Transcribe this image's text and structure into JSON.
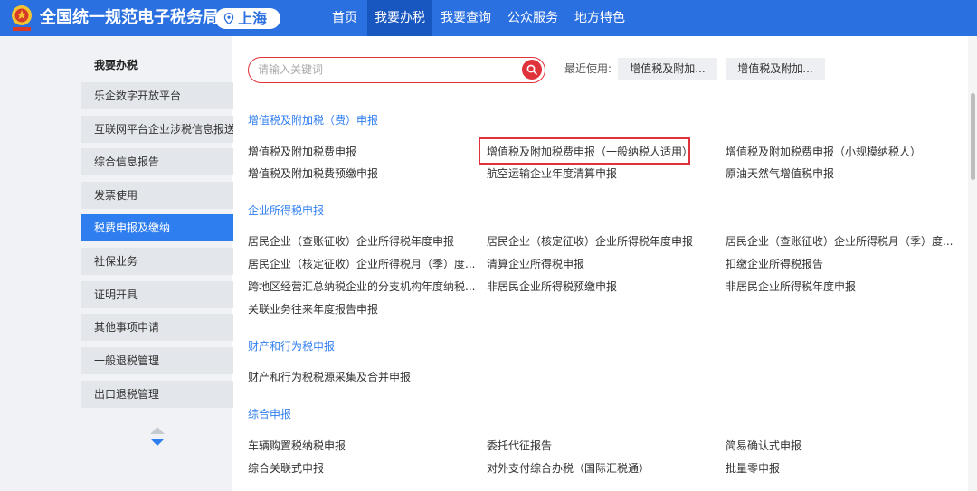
{
  "header": {
    "site_title": "全国统一规范电子税务局",
    "region": "上海",
    "nav": [
      "首页",
      "我要办税",
      "我要查询",
      "公众服务",
      "地方特色"
    ],
    "active_nav": "我要办税",
    "brand_color": "#2b70e0"
  },
  "sidebar": {
    "heading": "我要办税",
    "items": [
      "乐企数字开放平台",
      "互联网平台企业涉税信息报送",
      "综合信息报告",
      "发票使用",
      "税费申报及缴纳",
      "社保业务",
      "证明开具",
      "其他事项申请",
      "一般退税管理",
      "出口退税管理"
    ],
    "active_item": "税费申报及缴纳"
  },
  "search": {
    "placeholder": "请输入关键词",
    "recent_label": "最近使用:",
    "recent": [
      "增值税及附加...",
      "增值税及附加..."
    ]
  },
  "sections": [
    {
      "title": "增值税及附加税（费）申报",
      "items": [
        "增值税及附加税费申报",
        "增值税及附加税费申报（一般纳税人适用）",
        "增值税及附加税费申报（小规模纳税人）",
        "增值税及附加税费预缴申报",
        "航空运输企业年度清算申报",
        "原油天然气增值税申报"
      ]
    },
    {
      "title": "企业所得税申报",
      "items": [
        "居民企业（查账征收）企业所得税年度申报",
        "居民企业（核定征收）企业所得税年度申报",
        "居民企业（查账征收）企业所得税月（季）度...",
        "居民企业（核定征收）企业所得税月（季）度...",
        "清算企业所得税申报",
        "扣缴企业所得税报告",
        "跨地区经营汇总纳税企业的分支机构年度纳税...",
        "非居民企业所得税预缴申报",
        "非居民企业所得税年度申报",
        "关联业务往来年度报告申报"
      ]
    },
    {
      "title": "财产和行为税申报",
      "items": [
        "财产和行为税税源采集及合并申报"
      ]
    },
    {
      "title": "综合申报",
      "items": [
        "车辆购置税纳税申报",
        "委托代征报告",
        "简易确认式申报",
        "综合关联式申报",
        "对外支付综合办税（国际汇税通）",
        "批量零申报"
      ]
    }
  ],
  "highlighted_item": "增值税及附加税费申报（一般纳税人适用）",
  "accent_color": "#2f7ef0",
  "highlight_color": "#e0323a"
}
